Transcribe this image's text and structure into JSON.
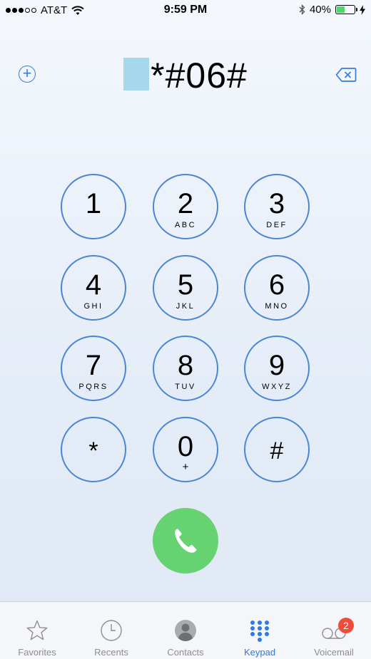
{
  "status_bar": {
    "signal_dots": [
      true,
      true,
      true,
      false,
      false
    ],
    "carrier": "AT&T",
    "time": "9:59 PM",
    "battery_percent": "40%",
    "battery_level": 0.4,
    "icons": [
      "wifi-icon",
      "bluetooth-icon",
      "battery-icon",
      "charging-bolt-icon"
    ]
  },
  "entry": {
    "selected_char": "",
    "number": "*#06#",
    "add_icon": "add-contact-icon",
    "delete_icon": "delete-backspace-icon"
  },
  "keypad": {
    "keys": [
      {
        "digit": "1",
        "letters": ""
      },
      {
        "digit": "2",
        "letters": "ABC"
      },
      {
        "digit": "3",
        "letters": "DEF"
      },
      {
        "digit": "4",
        "letters": "GHI"
      },
      {
        "digit": "5",
        "letters": "JKL"
      },
      {
        "digit": "6",
        "letters": "MNO"
      },
      {
        "digit": "7",
        "letters": "PQRS"
      },
      {
        "digit": "8",
        "letters": "TUV"
      },
      {
        "digit": "9",
        "letters": "WXYZ"
      },
      {
        "digit": "*",
        "letters": ""
      },
      {
        "digit": "0",
        "letters": "+"
      },
      {
        "digit": "#",
        "letters": ""
      }
    ],
    "call_icon": "phone-icon",
    "call_color": "#67d272",
    "ring_color": "#4a86d4"
  },
  "tab_bar": {
    "tabs": [
      {
        "label": "Favorites",
        "icon": "star-icon"
      },
      {
        "label": "Recents",
        "icon": "clock-icon"
      },
      {
        "label": "Contacts",
        "icon": "person-icon"
      },
      {
        "label": "Keypad",
        "icon": "keypad-grid-icon",
        "active": true
      },
      {
        "label": "Voicemail",
        "icon": "voicemail-icon",
        "badge": "2"
      }
    ],
    "active_color": "#2f7ae5",
    "badge_color": "#f04b3b"
  }
}
